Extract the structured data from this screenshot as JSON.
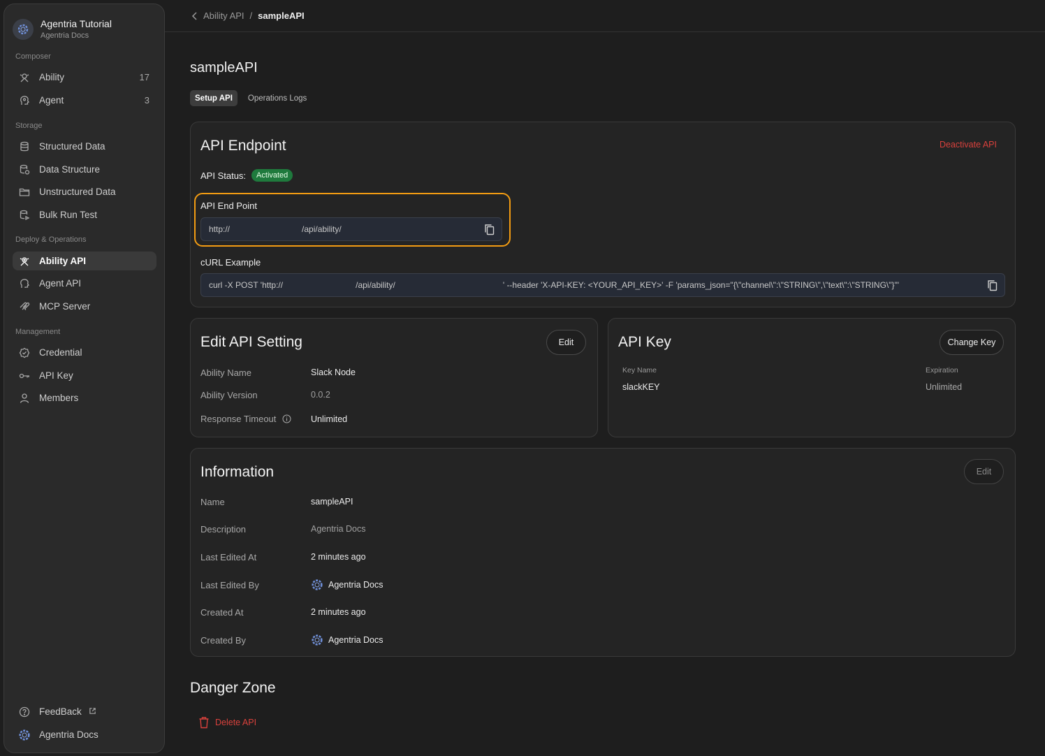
{
  "workspace": {
    "title": "Agentria Tutorial",
    "subtitle": "Agentria Docs"
  },
  "sidebar": {
    "sections": {
      "composer": "Composer",
      "storage": "Storage",
      "deploy": "Deploy & Operations",
      "management": "Management"
    },
    "items": [
      {
        "label": "Ability",
        "count": "17",
        "icon": "ability-icon"
      },
      {
        "label": "Agent",
        "count": "3",
        "icon": "agent-icon"
      },
      {
        "label": "Structured Data",
        "icon": "database-icon"
      },
      {
        "label": "Data Structure",
        "icon": "data-structure-icon"
      },
      {
        "label": "Unstructured Data",
        "icon": "folder-icon"
      },
      {
        "label": "Bulk Run Test",
        "icon": "bulk-test-icon"
      },
      {
        "label": "Ability API",
        "icon": "ability-api-icon",
        "active": true
      },
      {
        "label": "Agent API",
        "icon": "agent-api-icon"
      },
      {
        "label": "MCP Server",
        "icon": "mcp-icon"
      },
      {
        "label": "Credential",
        "icon": "credential-icon"
      },
      {
        "label": "API Key",
        "icon": "key-icon"
      },
      {
        "label": "Members",
        "icon": "person-icon"
      }
    ],
    "footer": {
      "feedback": "FeedBack",
      "user": "Agentria Docs"
    }
  },
  "breadcrumb": {
    "parent": "Ability API",
    "separator": "/",
    "current": "sampleAPI"
  },
  "page": {
    "title": "sampleAPI",
    "tabs": [
      {
        "label": "Setup API",
        "active": true
      },
      {
        "label": "Operations Logs"
      }
    ]
  },
  "endpoint_card": {
    "title": "API Endpoint",
    "deactivate_label": "Deactivate API",
    "status_label": "API Status:",
    "status_value": "Activated",
    "endpoint_label": "API End Point",
    "endpoint_prefix": "http://",
    "endpoint_suffix": "/api/ability/",
    "curl_label": "cURL Example",
    "curl_part1": "curl -X POST 'http://",
    "curl_part2": "/api/ability/",
    "curl_part3": "' --header 'X-API-KEY: <YOUR_API_KEY>' -F 'params_json=\"{\\\"channel\\\":\\\"STRING\\\",\\\"text\\\":\\\"STRING\\\"}\"'"
  },
  "settings_card": {
    "title": "Edit API Setting",
    "edit_label": "Edit",
    "rows": [
      {
        "label": "Ability Name",
        "value": "Slack Node"
      },
      {
        "label": "Ability Version",
        "value": "0.0.2"
      },
      {
        "label": "Response Timeout",
        "value": "Unlimited"
      }
    ]
  },
  "apikey_card": {
    "title": "API Key",
    "change_label": "Change Key",
    "key_name_label": "Key Name",
    "key_name_value": "slackKEY",
    "expiration_label": "Expiration",
    "expiration_value": "Unlimited"
  },
  "info_card": {
    "title": "Information",
    "edit_label": "Edit",
    "rows": [
      {
        "label": "Name",
        "value": "sampleAPI"
      },
      {
        "label": "Description",
        "value": "Agentria Docs"
      },
      {
        "label": "Last Edited At",
        "value": "2 minutes ago"
      },
      {
        "label": "Last Edited By",
        "value": "Agentria Docs"
      },
      {
        "label": "Created At",
        "value": "2 minutes ago"
      },
      {
        "label": "Created By",
        "value": "Agentria Docs"
      }
    ]
  },
  "danger": {
    "title": "Danger Zone",
    "delete_label": "Delete API"
  },
  "colors": {
    "accent_danger": "#d9413c",
    "status_green": "#1f7a3d",
    "highlight_orange": "#f39c12"
  }
}
